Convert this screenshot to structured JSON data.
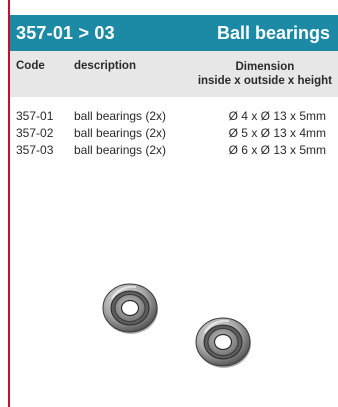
{
  "header": {
    "code_range": "357-01 > 03",
    "title": "Ball bearings"
  },
  "columns": {
    "code": "Code",
    "description": "description",
    "dimension_line1": "Dimension",
    "dimension_line2": "inside x outside x height"
  },
  "rows": [
    {
      "code": "357-01",
      "description": "ball bearings (2x)",
      "dimension": "Ø 4 x Ø 13 x 5mm"
    },
    {
      "code": "357-02",
      "description": "ball bearings (2x)",
      "dimension": "Ø 5 x Ø 13 x 4mm"
    },
    {
      "code": "357-03",
      "description": "ball bearings (2x)",
      "dimension": "Ø 6 x Ø 13 x 5mm"
    }
  ],
  "colors": {
    "header_bg": "#1c8aa5",
    "column_header_bg": "#e7e7e8",
    "left_rule": "#c8102e"
  }
}
